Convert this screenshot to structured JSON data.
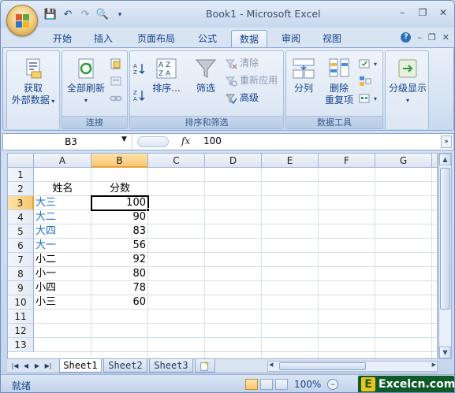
{
  "window": {
    "title": "Book1 - Microsoft Excel",
    "controls": [
      "–",
      "❐",
      "✕"
    ]
  },
  "quick_access": [
    "save-icon",
    "undo-icon",
    "redo-icon",
    "print-preview-icon",
    "customize-icon"
  ],
  "tabs": [
    {
      "label": "开始",
      "active": false
    },
    {
      "label": "插入",
      "active": false
    },
    {
      "label": "页面布局",
      "active": false
    },
    {
      "label": "公式",
      "active": false
    },
    {
      "label": "数据",
      "active": true
    },
    {
      "label": "审阅",
      "active": false
    },
    {
      "label": "视图",
      "active": false
    }
  ],
  "ribbon": {
    "get_external": {
      "line1": "获取",
      "line2": "外部数据"
    },
    "connections": {
      "refresh_all": "全部刷新",
      "group_label": "连接"
    },
    "sort_filter": {
      "sort": "排序...",
      "filter": "筛选",
      "clear": "清除",
      "reapply": "重新应用",
      "advanced": "高级",
      "group_label": "排序和筛选"
    },
    "data_tools": {
      "split": "分列",
      "remove_dup_line1": "删除",
      "remove_dup_line2": "重复项",
      "group_label": "数据工具"
    },
    "outline": {
      "label": "分级显示"
    }
  },
  "formula_bar": {
    "name_box": "B3",
    "fx": "fx",
    "value": "100"
  },
  "grid": {
    "columns": [
      "A",
      "B",
      "C",
      "D",
      "E",
      "F",
      "G"
    ],
    "selected_column": "B",
    "rows": [
      "1",
      "2",
      "3",
      "4",
      "5",
      "6",
      "7",
      "8",
      "9",
      "10",
      "11",
      "12",
      "13"
    ],
    "selected_row": "3",
    "header_row": {
      "a": "姓名",
      "b": "分数"
    },
    "data": [
      {
        "name": "大三",
        "score": "100",
        "link_color": true
      },
      {
        "name": "大二",
        "score": "90",
        "link_color": true
      },
      {
        "name": "大四",
        "score": "83",
        "link_color": true
      },
      {
        "name": "大一",
        "score": "56",
        "link_color": true
      },
      {
        "name": "小二",
        "score": "92",
        "link_color": false
      },
      {
        "name": "小一",
        "score": "80",
        "link_color": false
      },
      {
        "name": "小四",
        "score": "78",
        "link_color": false
      },
      {
        "name": "小三",
        "score": "60",
        "link_color": false
      }
    ]
  },
  "sheets": [
    "Sheet1",
    "Sheet2",
    "Sheet3"
  ],
  "active_sheet": "Sheet1",
  "status": {
    "ready": "就绪",
    "zoom": "100%"
  },
  "watermark": {
    "letter": "E",
    "text": "Excelcn.com"
  },
  "colors": {
    "blue_text": "#1f6fbf",
    "selection_header": "#f8c772",
    "ribbon_text": "#15428b"
  }
}
